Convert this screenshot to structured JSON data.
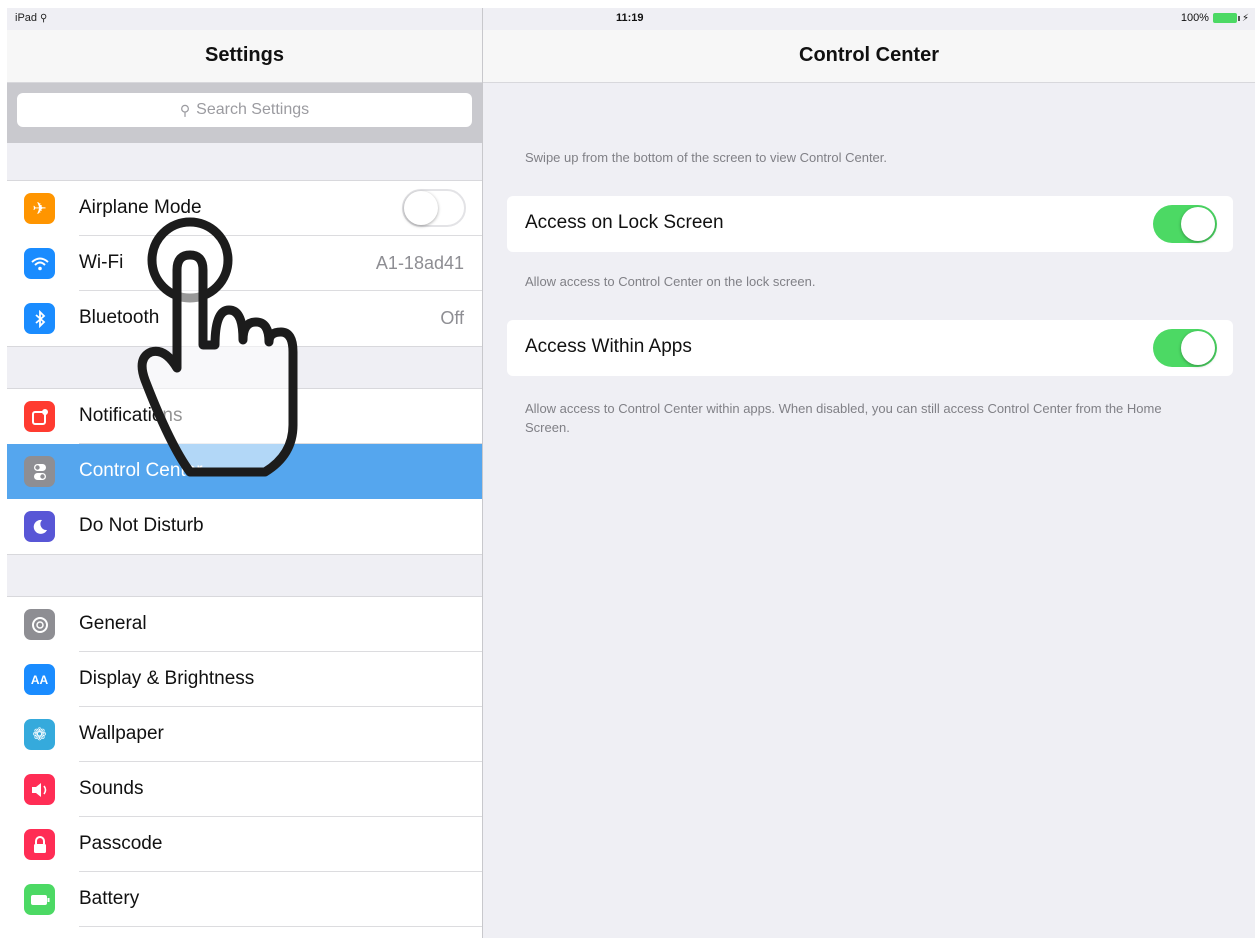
{
  "status_bar": {
    "device": "iPad",
    "time": "11:19",
    "battery": "100%"
  },
  "sidebar": {
    "title": "Settings",
    "search_placeholder": "Search Settings",
    "group1": [
      {
        "label": "Airplane Mode",
        "icon": "airplane-icon",
        "color": "#ff9500",
        "toggle": "off"
      },
      {
        "label": "Wi-Fi",
        "icon": "wifi-icon",
        "color": "#1a8cff",
        "value": "A1-18ad41"
      },
      {
        "label": "Bluetooth",
        "icon": "bluetooth-icon",
        "color": "#1a8cff",
        "value": "Off"
      }
    ],
    "group2": [
      {
        "label": "Notifications",
        "icon": "notifications-icon",
        "color": "#ff3b30"
      },
      {
        "label": "Control Center",
        "icon": "control-center-icon",
        "color": "#8e8e93",
        "selected": true
      },
      {
        "label": "Do Not Disturb",
        "icon": "moon-icon",
        "color": "#5856d6"
      }
    ],
    "group3": [
      {
        "label": "General",
        "icon": "gear-icon",
        "color": "#8e8e93"
      },
      {
        "label": "Display & Brightness",
        "icon": "display-icon",
        "color": "#1a8cff",
        "glyph": "AA"
      },
      {
        "label": "Wallpaper",
        "icon": "wallpaper-icon",
        "color": "#35aadc"
      },
      {
        "label": "Sounds",
        "icon": "speaker-icon",
        "color": "#ff2d55"
      },
      {
        "label": "Passcode",
        "icon": "lock-icon",
        "color": "#ff2d55"
      },
      {
        "label": "Battery",
        "icon": "battery-icon",
        "color": "#4cd964"
      }
    ]
  },
  "detail": {
    "title": "Control Center",
    "intro": "Swipe up from the bottom of the screen to view Control Center.",
    "rows": [
      {
        "label": "Access on Lock Screen",
        "toggle": "on",
        "footer": "Allow access to Control Center on the lock screen."
      },
      {
        "label": "Access Within Apps",
        "toggle": "on",
        "footer": "Allow access to Control Center within apps. When disabled, you can still access Control Center from the Home Screen."
      }
    ]
  },
  "colors": {
    "selected_row": "#55a6ee",
    "toggle_on": "#4cd964",
    "accent": "#1a8cff"
  }
}
